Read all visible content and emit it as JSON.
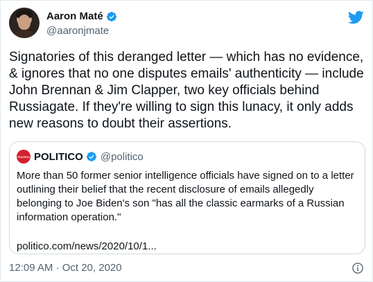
{
  "author": {
    "name": "Aaron Maté",
    "handle": "@aaronjmate"
  },
  "tweet": {
    "text": "Signatories of this deranged letter — which has no evidence,\n& ignores that no one disputes emails' authenticity — include\nJohn Brennan & Jim Clapper, two key officials behind\nRussiagate. If they're willing to sign this lunacy, it only adds\nnew reasons to doubt their assertions."
  },
  "quote": {
    "logo_text": "POLITICO",
    "name": "POLITICO",
    "handle": "@politico",
    "text": "More than 50 former senior intelligence officials have signed on to a letter outlining their belief that the recent disclosure of emails allegedly belonging to Joe Biden's son \"has all the classic earmarks of a Russian information operation.\"",
    "link": "politico.com/news/2020/10/1..."
  },
  "meta": {
    "timestamp": "12:09 AM · Oct 20, 2020"
  },
  "colors": {
    "verified": "#1d9bf0",
    "twitter_bird": "#1d9bf0",
    "politico_red": "#d4202c",
    "secondary_text": "#536471"
  },
  "icons": {
    "verified": "verified-badge-icon",
    "bird": "twitter-bird-icon",
    "info": "info-icon"
  }
}
